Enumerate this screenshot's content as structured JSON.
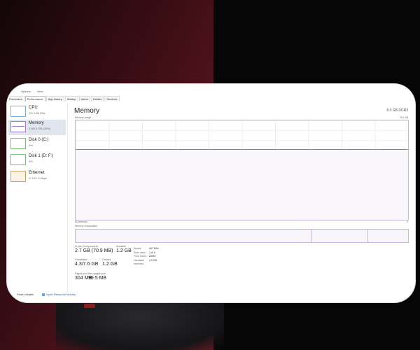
{
  "menu": [
    "Options",
    "View"
  ],
  "tabs": [
    "Processes",
    "Performance",
    "App history",
    "Startup",
    "Users",
    "Details",
    "Services"
  ],
  "sidebar": [
    {
      "title": "CPU",
      "sub": "2% 1.56 GHz"
    },
    {
      "title": "Memory",
      "sub": "2.6/8.0 GB (33%)"
    },
    {
      "title": "Disk 0 (C:)",
      "sub": "0%"
    },
    {
      "title": "Disk 1 (D: F:)",
      "sub": "0%"
    },
    {
      "title": "Ethernet",
      "sub": "S: 0 R: 0 Kbps"
    }
  ],
  "main": {
    "title": "Memory",
    "total": "8.0 GB DDR3",
    "usage_label": "Memory usage",
    "usage_max": "8.0 GB",
    "axis_left": "60 seconds",
    "axis_right": "0",
    "composition_label": "Memory composition"
  },
  "stats": {
    "in_use_label": "In use (Compressed)",
    "in_use_value": "2.7 GB (70.9 MB)",
    "available_label": "Available",
    "available_value": "1.2 GB",
    "committed_label": "Committed",
    "committed_value": "4.3/7.6 GB",
    "cached_label": "Cached",
    "cached_value": "1.2 GB",
    "paged_label": "Paged pool",
    "paged_value": "304 MB",
    "nonpaged_label": "Non-paged pool",
    "nonpaged_value": "99.5 MB"
  },
  "details": [
    {
      "k": "Speed:",
      "v": "667 MHz"
    },
    {
      "k": "Slots used:",
      "v": "2 of 4"
    },
    {
      "k": "Form factor:",
      "v": "DIMM"
    },
    {
      "k": "Hardware reserved:",
      "v": "4.0 GB"
    }
  ],
  "footer": {
    "fewer": "Fewer details",
    "link": "Open Resource Monitor"
  }
}
